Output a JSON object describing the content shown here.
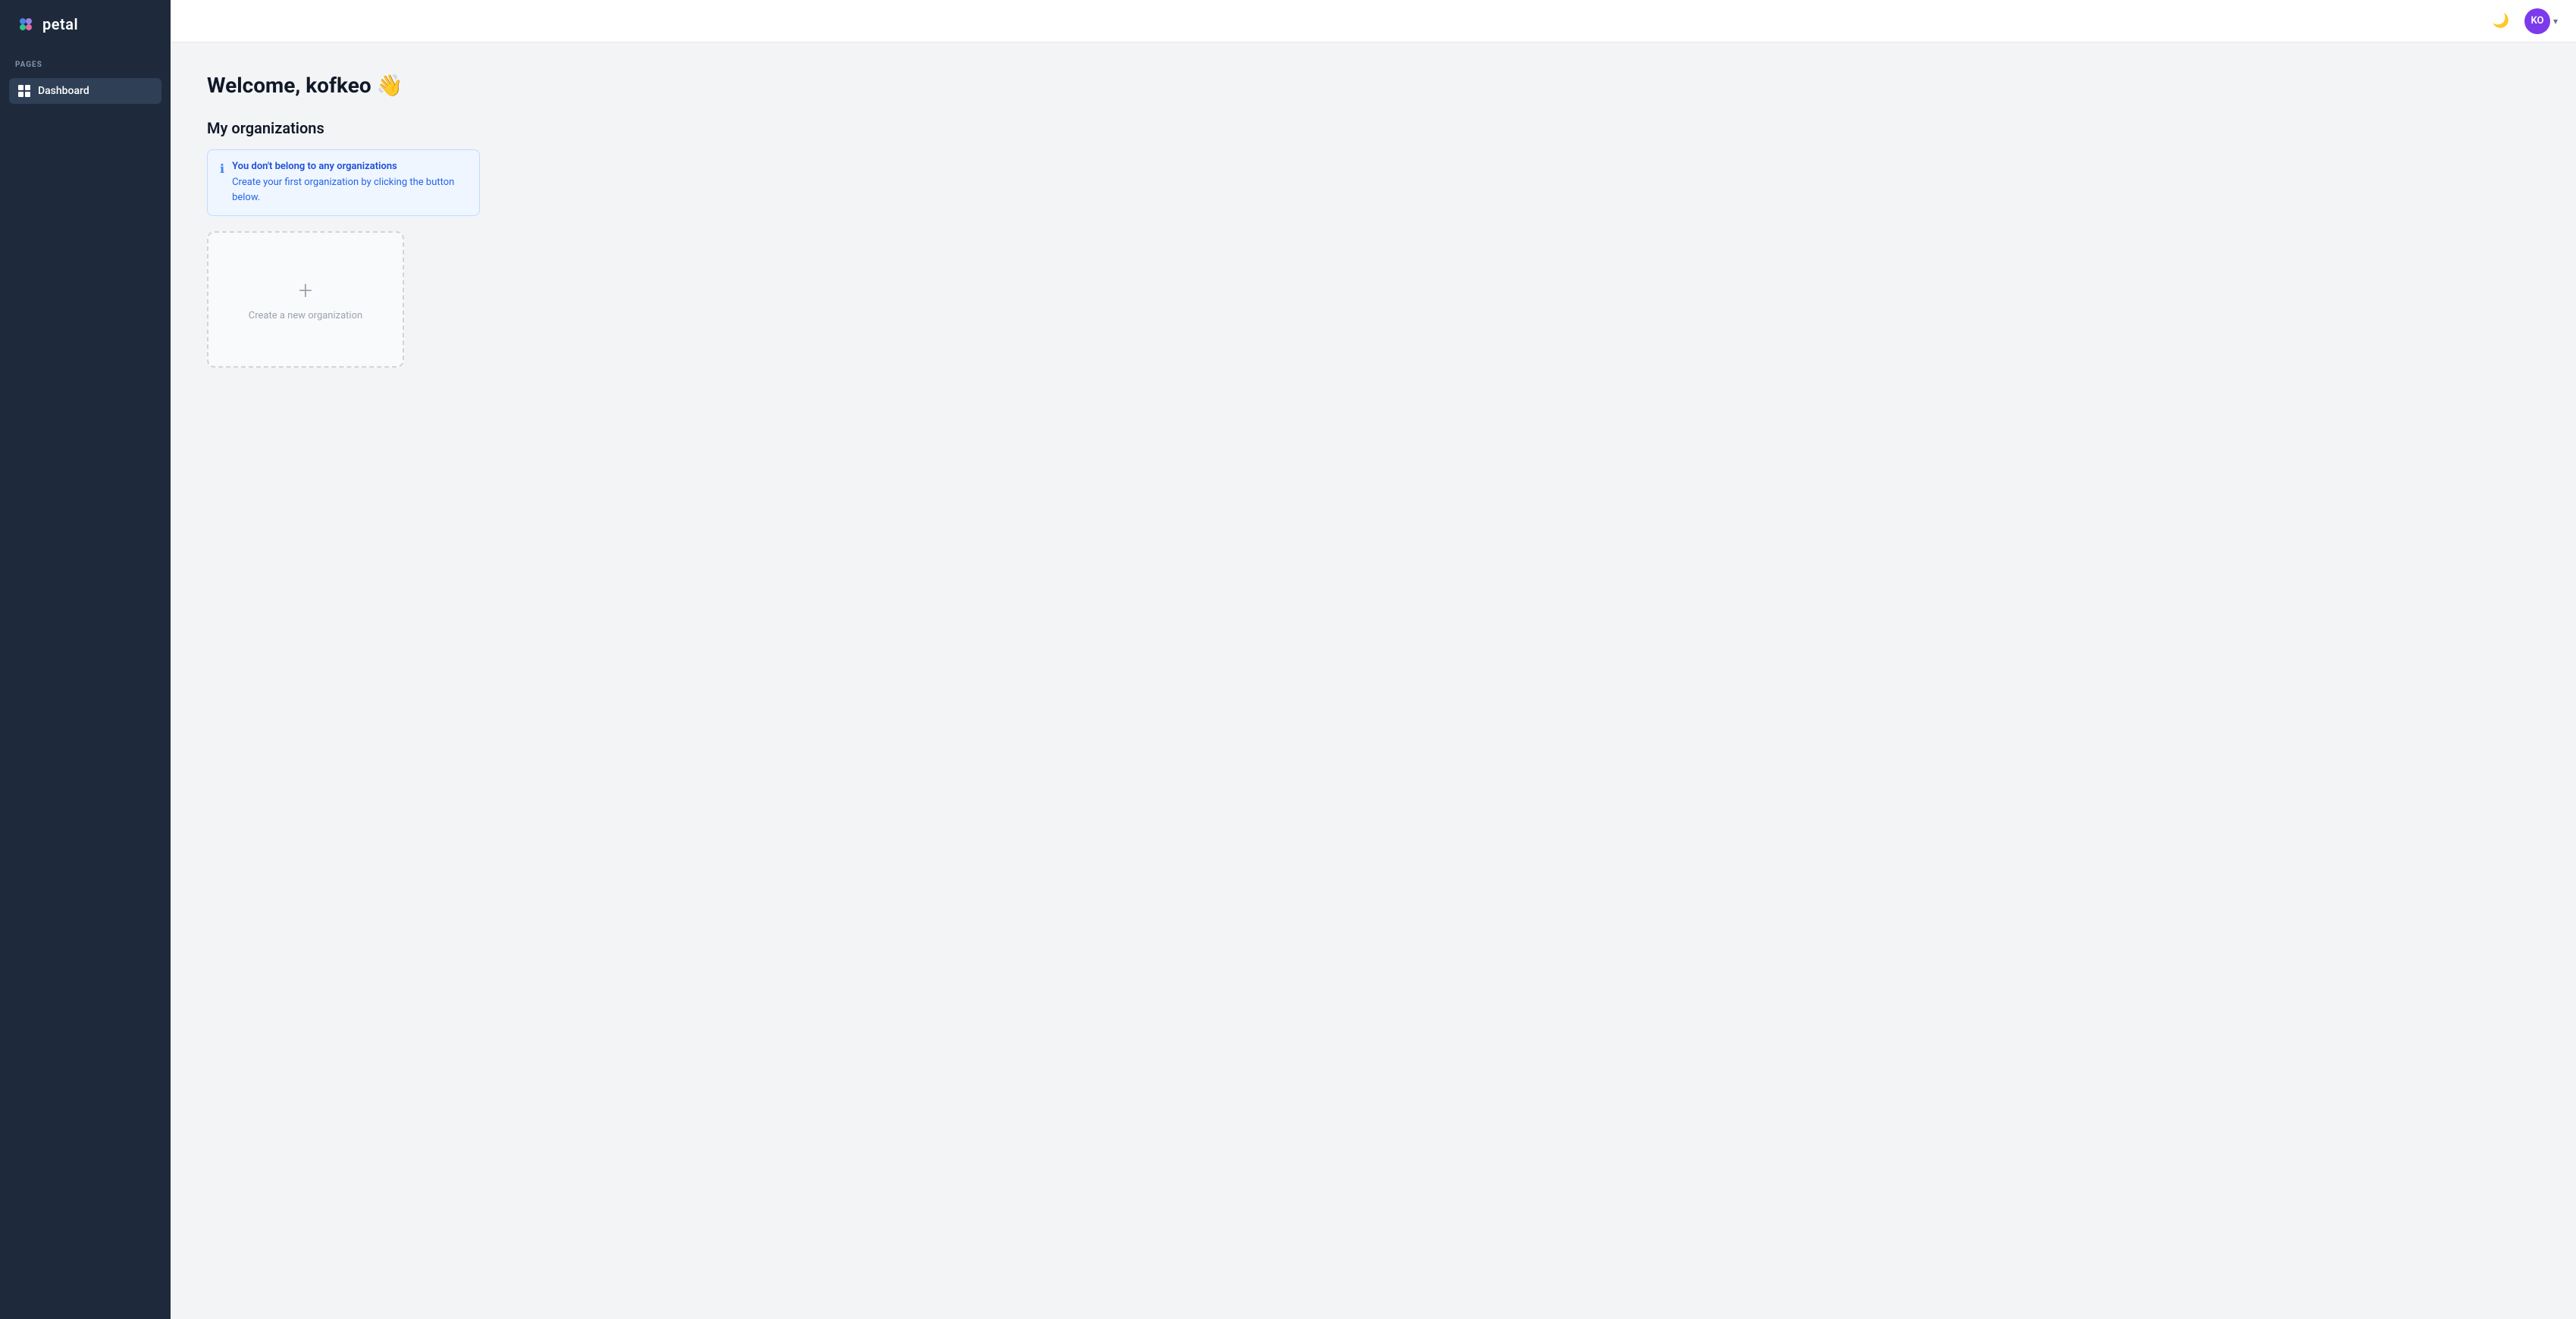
{
  "sidebar": {
    "logo_text": "petal",
    "section_label": "PAGES",
    "nav_items": [
      {
        "id": "dashboard",
        "label": "Dashboard",
        "active": true
      }
    ]
  },
  "header": {
    "theme_toggle_icon": "moon",
    "user_initials": "KO",
    "user_avatar_color": "#7c3aed"
  },
  "main": {
    "welcome_title": "Welcome, kofkeo",
    "wave_emoji": "👋",
    "organizations_section_title": "My organizations",
    "info_banner": {
      "icon": "ℹ",
      "title": "You don't belong to any organizations",
      "description": "Create your first organization by clicking the button below."
    },
    "create_org_card": {
      "plus_icon": "+",
      "label": "Create a new organization"
    }
  }
}
